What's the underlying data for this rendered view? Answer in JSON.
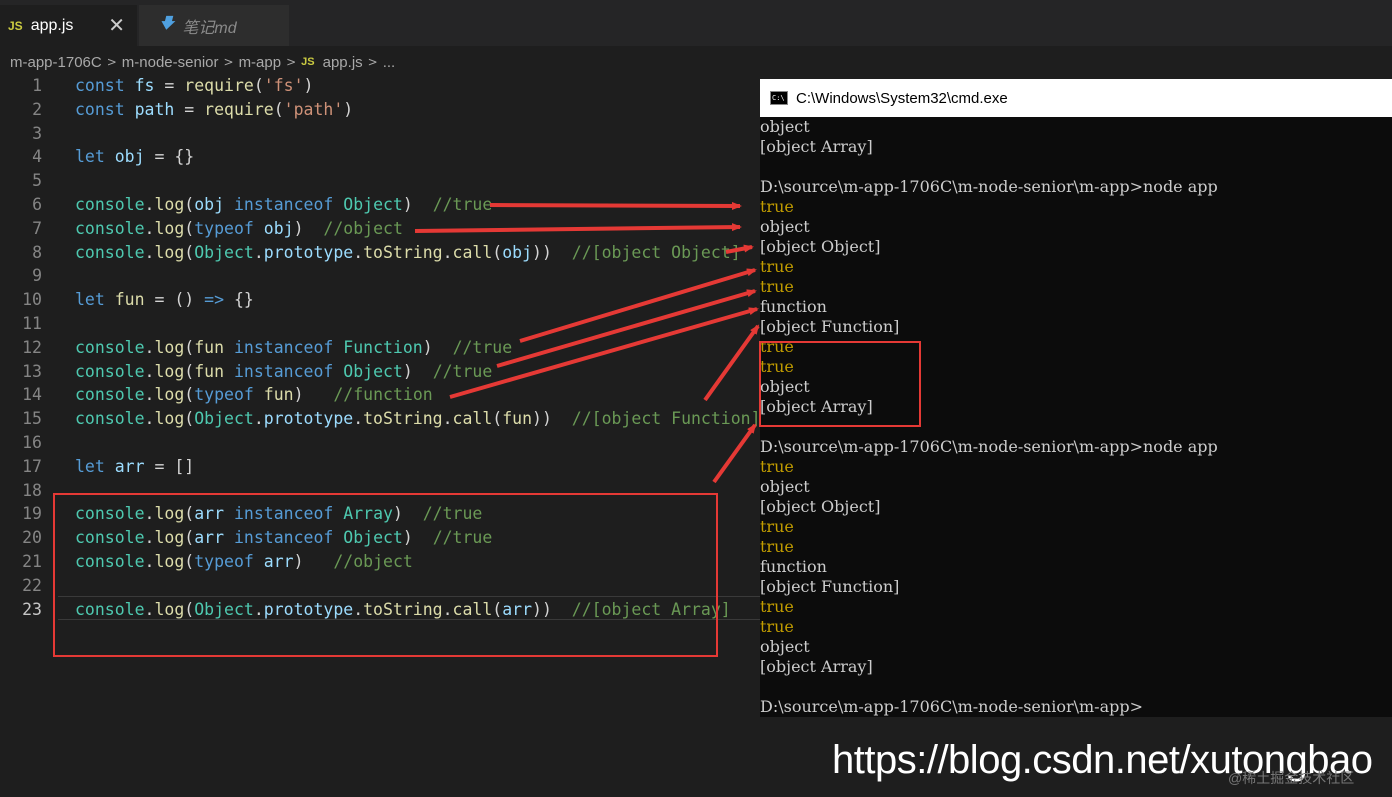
{
  "tabs": [
    {
      "icon": "JS",
      "label": "app.js",
      "active": true,
      "close": "✕"
    },
    {
      "icon": "markdown-icon",
      "label": "笔记md",
      "active": false
    }
  ],
  "breadcrumb": [
    "m-app-1706C",
    "m-node-senior",
    "m-app",
    "app.js",
    "..."
  ],
  "code_lines": [
    {
      "n": "1",
      "tokens": [
        [
          "kw",
          "const "
        ],
        [
          "var",
          "fs"
        ],
        [
          "p",
          " = "
        ],
        [
          "fn",
          "require"
        ],
        [
          "p",
          "("
        ],
        [
          "str",
          "'fs'"
        ],
        [
          "p",
          ")"
        ]
      ]
    },
    {
      "n": "2",
      "tokens": [
        [
          "kw",
          "const "
        ],
        [
          "var",
          "path"
        ],
        [
          "p",
          " = "
        ],
        [
          "fn",
          "require"
        ],
        [
          "p",
          "("
        ],
        [
          "str",
          "'path'"
        ],
        [
          "p",
          ")"
        ]
      ]
    },
    {
      "n": "3",
      "tokens": []
    },
    {
      "n": "4",
      "tokens": [
        [
          "kw",
          "let "
        ],
        [
          "var",
          "obj"
        ],
        [
          "p",
          " = {}"
        ]
      ]
    },
    {
      "n": "5",
      "tokens": []
    },
    {
      "n": "6",
      "tokens": [
        [
          "cls",
          "console"
        ],
        [
          "p",
          "."
        ],
        [
          "fn",
          "log"
        ],
        [
          "p",
          "("
        ],
        [
          "var",
          "obj "
        ],
        [
          "kw",
          "instanceof "
        ],
        [
          "cls",
          "Object"
        ],
        [
          "p",
          ")  "
        ],
        [
          "cm",
          "//true"
        ]
      ]
    },
    {
      "n": "7",
      "tokens": [
        [
          "cls",
          "console"
        ],
        [
          "p",
          "."
        ],
        [
          "fn",
          "log"
        ],
        [
          "p",
          "("
        ],
        [
          "kw",
          "typeof "
        ],
        [
          "var",
          "obj"
        ],
        [
          "p",
          ")  "
        ],
        [
          "cm",
          "//object"
        ]
      ]
    },
    {
      "n": "8",
      "tokens": [
        [
          "cls",
          "console"
        ],
        [
          "p",
          "."
        ],
        [
          "fn",
          "log"
        ],
        [
          "p",
          "("
        ],
        [
          "cls",
          "Object"
        ],
        [
          "p",
          "."
        ],
        [
          "var",
          "prototype"
        ],
        [
          "p",
          "."
        ],
        [
          "fn",
          "toString"
        ],
        [
          "p",
          "."
        ],
        [
          "fn",
          "call"
        ],
        [
          "p",
          "("
        ],
        [
          "var",
          "obj"
        ],
        [
          "p",
          "))  "
        ],
        [
          "cm",
          "//[object Object]"
        ]
      ]
    },
    {
      "n": "9",
      "tokens": []
    },
    {
      "n": "10",
      "tokens": [
        [
          "kw",
          "let "
        ],
        [
          "fn",
          "fun"
        ],
        [
          "p",
          " = () "
        ],
        [
          "kw",
          "=>"
        ],
        [
          "p",
          " {}"
        ]
      ]
    },
    {
      "n": "11",
      "tokens": []
    },
    {
      "n": "12",
      "tokens": [
        [
          "cls",
          "console"
        ],
        [
          "p",
          "."
        ],
        [
          "fn",
          "log"
        ],
        [
          "p",
          "("
        ],
        [
          "fn",
          "fun "
        ],
        [
          "kw",
          "instanceof "
        ],
        [
          "cls",
          "Function"
        ],
        [
          "p",
          ")  "
        ],
        [
          "cm",
          "//true"
        ]
      ]
    },
    {
      "n": "13",
      "tokens": [
        [
          "cls",
          "console"
        ],
        [
          "p",
          "."
        ],
        [
          "fn",
          "log"
        ],
        [
          "p",
          "("
        ],
        [
          "fn",
          "fun "
        ],
        [
          "kw",
          "instanceof "
        ],
        [
          "cls",
          "Object"
        ],
        [
          "p",
          ")  "
        ],
        [
          "cm",
          "//true"
        ]
      ]
    },
    {
      "n": "14",
      "tokens": [
        [
          "cls",
          "console"
        ],
        [
          "p",
          "."
        ],
        [
          "fn",
          "log"
        ],
        [
          "p",
          "("
        ],
        [
          "kw",
          "typeof "
        ],
        [
          "fn",
          "fun"
        ],
        [
          "p",
          ")   "
        ],
        [
          "cm",
          "//function"
        ]
      ]
    },
    {
      "n": "15",
      "tokens": [
        [
          "cls",
          "console"
        ],
        [
          "p",
          "."
        ],
        [
          "fn",
          "log"
        ],
        [
          "p",
          "("
        ],
        [
          "cls",
          "Object"
        ],
        [
          "p",
          "."
        ],
        [
          "var",
          "prototype"
        ],
        [
          "p",
          "."
        ],
        [
          "fn",
          "toString"
        ],
        [
          "p",
          "."
        ],
        [
          "fn",
          "call"
        ],
        [
          "p",
          "("
        ],
        [
          "fn",
          "fun"
        ],
        [
          "p",
          "))  "
        ],
        [
          "cm",
          "//[object Function]"
        ]
      ]
    },
    {
      "n": "16",
      "tokens": []
    },
    {
      "n": "17",
      "tokens": [
        [
          "kw",
          "let "
        ],
        [
          "var",
          "arr"
        ],
        [
          "p",
          " = []"
        ]
      ]
    },
    {
      "n": "18",
      "tokens": []
    },
    {
      "n": "19",
      "tokens": [
        [
          "cls",
          "console"
        ],
        [
          "p",
          "."
        ],
        [
          "fn",
          "log"
        ],
        [
          "p",
          "("
        ],
        [
          "var",
          "arr "
        ],
        [
          "kw",
          "instanceof "
        ],
        [
          "cls",
          "Array"
        ],
        [
          "p",
          ")  "
        ],
        [
          "cm",
          "//true"
        ]
      ]
    },
    {
      "n": "20",
      "tokens": [
        [
          "cls",
          "console"
        ],
        [
          "p",
          "."
        ],
        [
          "fn",
          "log"
        ],
        [
          "p",
          "("
        ],
        [
          "var",
          "arr "
        ],
        [
          "kw",
          "instanceof "
        ],
        [
          "cls",
          "Object"
        ],
        [
          "p",
          ")  "
        ],
        [
          "cm",
          "//true"
        ]
      ]
    },
    {
      "n": "21",
      "tokens": [
        [
          "cls",
          "console"
        ],
        [
          "p",
          "."
        ],
        [
          "fn",
          "log"
        ],
        [
          "p",
          "("
        ],
        [
          "kw",
          "typeof "
        ],
        [
          "var",
          "arr"
        ],
        [
          "p",
          ")   "
        ],
        [
          "cm",
          "//object"
        ]
      ]
    },
    {
      "n": "22",
      "tokens": []
    },
    {
      "n": "23",
      "tokens": [
        [
          "cls",
          "console"
        ],
        [
          "p",
          "."
        ],
        [
          "fn",
          "log"
        ],
        [
          "p",
          "("
        ],
        [
          "cls",
          "Object"
        ],
        [
          "p",
          "."
        ],
        [
          "var",
          "prototype"
        ],
        [
          "p",
          "."
        ],
        [
          "fn",
          "toString"
        ],
        [
          "p",
          "."
        ],
        [
          "fn",
          "call"
        ],
        [
          "p",
          "("
        ],
        [
          "var",
          "arr"
        ],
        [
          "p",
          "))  "
        ],
        [
          "cm",
          "//[object Array]"
        ]
      ]
    }
  ],
  "active_line": "23",
  "cmd": {
    "title": "C:\\Windows\\System32\\cmd.exe",
    "lines": [
      {
        "t": "object",
        "c": "w"
      },
      {
        "t": "[object Array]",
        "c": "w"
      },
      {
        "t": "",
        "c": "w"
      },
      {
        "t": "D:\\source\\m-app-1706C\\m-node-senior\\m-app>node app",
        "c": "w"
      },
      {
        "t": "true",
        "c": "y"
      },
      {
        "t": "object",
        "c": "w"
      },
      {
        "t": "[object Object]",
        "c": "w"
      },
      {
        "t": "true",
        "c": "y"
      },
      {
        "t": "true",
        "c": "y"
      },
      {
        "t": "function",
        "c": "w"
      },
      {
        "t": "[object Function]",
        "c": "w"
      },
      {
        "t": "true",
        "c": "y"
      },
      {
        "t": "true",
        "c": "y"
      },
      {
        "t": "object",
        "c": "w"
      },
      {
        "t": "[object Array]",
        "c": "w"
      },
      {
        "t": "",
        "c": "w"
      },
      {
        "t": "D:\\source\\m-app-1706C\\m-node-senior\\m-app>node app",
        "c": "w"
      },
      {
        "t": "true",
        "c": "y"
      },
      {
        "t": "object",
        "c": "w"
      },
      {
        "t": "[object Object]",
        "c": "w"
      },
      {
        "t": "true",
        "c": "y"
      },
      {
        "t": "true",
        "c": "y"
      },
      {
        "t": "function",
        "c": "w"
      },
      {
        "t": "[object Function]",
        "c": "w"
      },
      {
        "t": "true",
        "c": "y"
      },
      {
        "t": "true",
        "c": "y"
      },
      {
        "t": "object",
        "c": "w"
      },
      {
        "t": "[object Array]",
        "c": "w"
      },
      {
        "t": "",
        "c": "w"
      },
      {
        "t": "D:\\source\\m-app-1706C\\m-node-senior\\m-app>",
        "c": "w"
      }
    ]
  },
  "watermark": "https://blog.csdn.net/xutongbao",
  "watermark_small": "@稀土掘金技术社区",
  "colors": {
    "annotation_red": "#e53935",
    "editor_bg": "#1e1e1e",
    "cmd_bg": "#0c0c0c",
    "cmd_yellow": "#c19c00"
  }
}
